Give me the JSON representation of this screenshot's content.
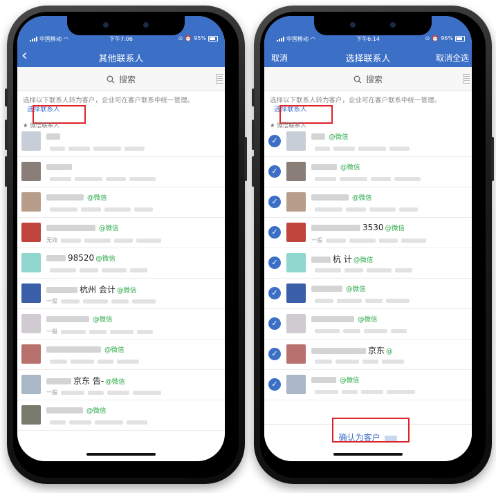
{
  "left_phone": {
    "status": {
      "carrier": "中国移动",
      "time": "下午7:06",
      "battery": "95%"
    },
    "nav": {
      "back_icon": "chevron-left-icon",
      "title": "其他联系人"
    },
    "search": {
      "placeholder": "搜索"
    },
    "hint": {
      "text": "选择以下联系人转为客户，企业可在客户联系中统一管理。",
      "link": "选择联系人"
    },
    "section_label": "★ 微信联系人",
    "contacts": [
      {
        "name": "",
        "tag": "",
        "sub": ""
      },
      {
        "name": "",
        "tag": "",
        "sub": ""
      },
      {
        "name": "",
        "tag": "@微信",
        "sub": ""
      },
      {
        "name": "",
        "tag": "@微信",
        "sub": "无效"
      },
      {
        "name": "98520",
        "tag": "@微信",
        "sub": ""
      },
      {
        "name": "杭州 会计",
        "tag": "@微信",
        "sub": "一般"
      },
      {
        "name": "",
        "tag": "@微信",
        "sub": "一般"
      },
      {
        "name": "",
        "tag": "@微信",
        "sub": ""
      },
      {
        "name": "京东 告-",
        "tag": "@微信",
        "sub": "一般"
      },
      {
        "name": "",
        "tag": "@微信",
        "sub": ""
      }
    ]
  },
  "right_phone": {
    "status": {
      "carrier": "中国移动",
      "time": "下午6:14",
      "battery": "96%"
    },
    "nav": {
      "left": "取消",
      "title": "选择联系人",
      "right": "取消全选"
    },
    "search": {
      "placeholder": "搜索"
    },
    "hint": {
      "text": "选择以下联系人转为客户，企业可在客户联系中统一管理。",
      "link": "选择联系人"
    },
    "section_label": "★ 微信联系人",
    "contacts": [
      {
        "name": "",
        "tag": "@微信",
        "sub": ""
      },
      {
        "name": "",
        "tag": "@微信",
        "sub": ""
      },
      {
        "name": "",
        "tag": "@微信",
        "sub": ""
      },
      {
        "name": "3530",
        "tag": "@微信",
        "sub": "一般"
      },
      {
        "name": "杭 计",
        "tag": "@微信",
        "sub": ""
      },
      {
        "name": "",
        "tag": "@微信",
        "sub": ""
      },
      {
        "name": "",
        "tag": "@微信",
        "sub": ""
      },
      {
        "name": "京东",
        "tag": "@",
        "sub": ""
      },
      {
        "name": "",
        "tag": "@微信",
        "sub": ""
      }
    ],
    "confirm_label": "确认为客户"
  },
  "colors": {
    "brand_blue": "#3c6fc6",
    "wechat_green": "#2ca84a",
    "highlight_red": "#e0222a"
  }
}
